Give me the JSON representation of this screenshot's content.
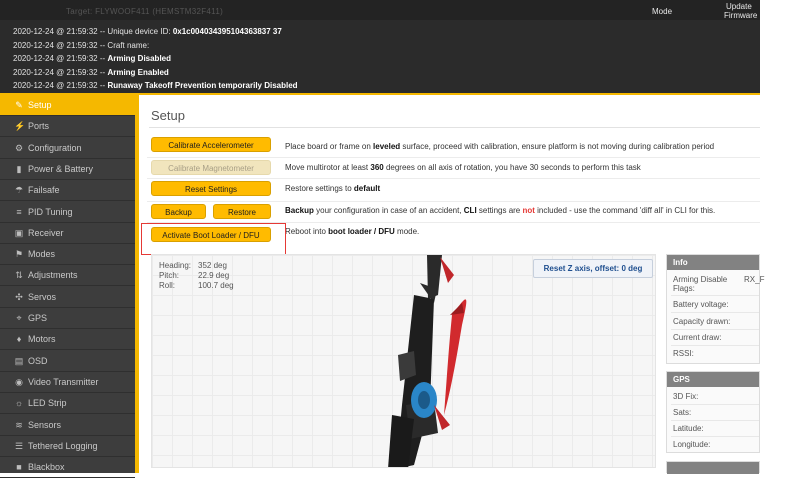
{
  "header": {
    "target": "Target: FLYWOOF411 (HEMSTM32F411)",
    "mode_label": "Mode",
    "update_label": "Update",
    "firmware_label": "Firmware"
  },
  "log": [
    {
      "time": "2020-12-24 @ 21:59:32",
      "text": "-- Unique device ID:",
      "bold": "0x1c004034395104363837 37"
    },
    {
      "time": "2020-12-24 @ 21:59:32",
      "text": "-- Craft name:",
      "bold": ""
    },
    {
      "time": "2020-12-24 @ 21:59:32",
      "text": "--",
      "bold": "Arming Disabled"
    },
    {
      "time": "2020-12-24 @ 21:59:32",
      "text": "--",
      "bold": "Arming Enabled"
    },
    {
      "time": "2020-12-24 @ 21:59:32",
      "text": "--",
      "bold": "Runaway Takeoff Prevention temporarily Disabled"
    }
  ],
  "sidebar": {
    "items": [
      {
        "label": "Setup",
        "icon": "wrench-icon",
        "glyph": "✎",
        "active": true
      },
      {
        "label": "Ports",
        "icon": "plug-icon",
        "glyph": "⚡",
        "active": false
      },
      {
        "label": "Configuration",
        "icon": "gear-icon",
        "glyph": "⚙",
        "active": false
      },
      {
        "label": "Power & Battery",
        "icon": "battery-icon",
        "glyph": "▮",
        "active": false
      },
      {
        "label": "Failsafe",
        "icon": "failsafe-icon",
        "glyph": "☂",
        "active": false
      },
      {
        "label": "PID Tuning",
        "icon": "pid-icon",
        "glyph": "≡",
        "active": false
      },
      {
        "label": "Receiver",
        "icon": "receiver-icon",
        "glyph": "▣",
        "active": false
      },
      {
        "label": "Modes",
        "icon": "modes-icon",
        "glyph": "⚑",
        "active": false
      },
      {
        "label": "Adjustments",
        "icon": "adjustments-icon",
        "glyph": "⇅",
        "active": false
      },
      {
        "label": "Servos",
        "icon": "servo-icon",
        "glyph": "✣",
        "active": false
      },
      {
        "label": "GPS",
        "icon": "gps-icon",
        "glyph": "⌖",
        "active": false
      },
      {
        "label": "Motors",
        "icon": "motor-icon",
        "glyph": "♦",
        "active": false
      },
      {
        "label": "OSD",
        "icon": "osd-icon",
        "glyph": "▤",
        "active": false
      },
      {
        "label": "Video Transmitter",
        "icon": "vtx-icon",
        "glyph": "◉",
        "active": false
      },
      {
        "label": "LED Strip",
        "icon": "led-icon",
        "glyph": "☼",
        "active": false
      },
      {
        "label": "Sensors",
        "icon": "sensors-icon",
        "glyph": "≋",
        "active": false
      },
      {
        "label": "Tethered Logging",
        "icon": "logging-icon",
        "glyph": "☰",
        "active": false
      },
      {
        "label": "Blackbox",
        "icon": "blackbox-icon",
        "glyph": "■",
        "active": false
      }
    ]
  },
  "main": {
    "title": "Setup",
    "calibrate_acc": {
      "label": "Calibrate Accelerometer",
      "desc_pre": "Place board or frame on ",
      "desc_bold": "leveled",
      "desc_post": " surface, proceed with calibration, ensure platform is not moving during calibration period"
    },
    "calibrate_mag": {
      "label": "Calibrate Magnetometer",
      "desc_pre": "Move multirotor at least ",
      "desc_bold": "360",
      "desc_post": " degrees on all axis of rotation, you have 30 seconds to perform this task"
    },
    "reset_settings": {
      "label": "Reset Settings",
      "desc_pre": "Restore settings to ",
      "desc_bold": "default"
    },
    "backup": {
      "label": "Backup",
      "restore_label": "Restore",
      "desc_bold1": "Backup",
      "desc_mid1": " your configuration in case of an accident, ",
      "desc_bold2": "CLI",
      "desc_mid2": " settings are ",
      "desc_red": "not",
      "desc_post": " included - use the command 'diff all' in CLI for this."
    },
    "bootloader": {
      "label": "Activate Boot Loader / DFU",
      "desc_pre": "Reboot into ",
      "desc_bold": "boot loader / DFU",
      "desc_post": " mode."
    }
  },
  "attitude": {
    "heading_label": "Heading:",
    "heading_val": "352 deg",
    "pitch_label": "Pitch:",
    "pitch_val": "22.9 deg",
    "roll_label": "Roll:",
    "roll_val": "100.7 deg",
    "reset_z": "Reset Z axis, offset: 0 deg"
  },
  "info": {
    "title": "Info",
    "arming_label": "Arming Disable Flags:",
    "arming_val": "RX_F",
    "battery_label": "Battery voltage:",
    "capacity_label": "Capacity drawn:",
    "current_label": "Current draw:",
    "rssi_label": "RSSI:"
  },
  "gps": {
    "title": "GPS",
    "fix_label": "3D Fix:",
    "sats_label": "Sats:",
    "lat_label": "Latitude:",
    "lon_label": "Longitude:"
  }
}
